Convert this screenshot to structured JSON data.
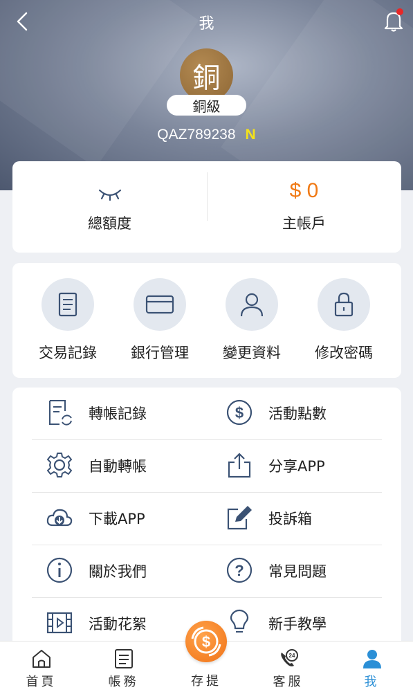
{
  "header": {
    "title": "我"
  },
  "profile": {
    "medal_char": "銅",
    "level": "銅級",
    "user_id": "QAZ789238",
    "badge": "N"
  },
  "balance": {
    "total_label": "總額度",
    "main_amount": "$ 0",
    "main_label": "主帳戶"
  },
  "quick_actions": [
    {
      "label": "交易記錄",
      "icon": "document-icon"
    },
    {
      "label": "銀行管理",
      "icon": "credit-card-icon"
    },
    {
      "label": "變更資料",
      "icon": "user-icon"
    },
    {
      "label": "修改密碼",
      "icon": "lock-icon"
    }
  ],
  "menu": [
    {
      "label": "轉帳記錄",
      "icon": "transfer-record-icon"
    },
    {
      "label": "活動點數",
      "icon": "dollar-circle-icon"
    },
    {
      "label": "自動轉帳",
      "icon": "gear-icon"
    },
    {
      "label": "分享APP",
      "icon": "share-icon"
    },
    {
      "label": "下載APP",
      "icon": "cloud-download-icon"
    },
    {
      "label": "投訴箱",
      "icon": "edit-icon"
    },
    {
      "label": "關於我們",
      "icon": "info-icon"
    },
    {
      "label": "常見問題",
      "icon": "question-icon"
    },
    {
      "label": "活動花絮",
      "icon": "film-icon"
    },
    {
      "label": "新手教學",
      "icon": "lightbulb-icon"
    }
  ],
  "tabs": [
    {
      "label": "首頁",
      "icon": "home-icon"
    },
    {
      "label": "帳務",
      "icon": "ledger-icon"
    },
    {
      "label": "存提",
      "icon": "deposit-icon"
    },
    {
      "label": "客服",
      "icon": "support-24-icon"
    },
    {
      "label": "我",
      "icon": "user-icon"
    }
  ],
  "colors": {
    "accent": "#f07a16",
    "active_tab": "#2b8fd6",
    "icon": "#3b5274",
    "badge": "#f4e21a"
  }
}
